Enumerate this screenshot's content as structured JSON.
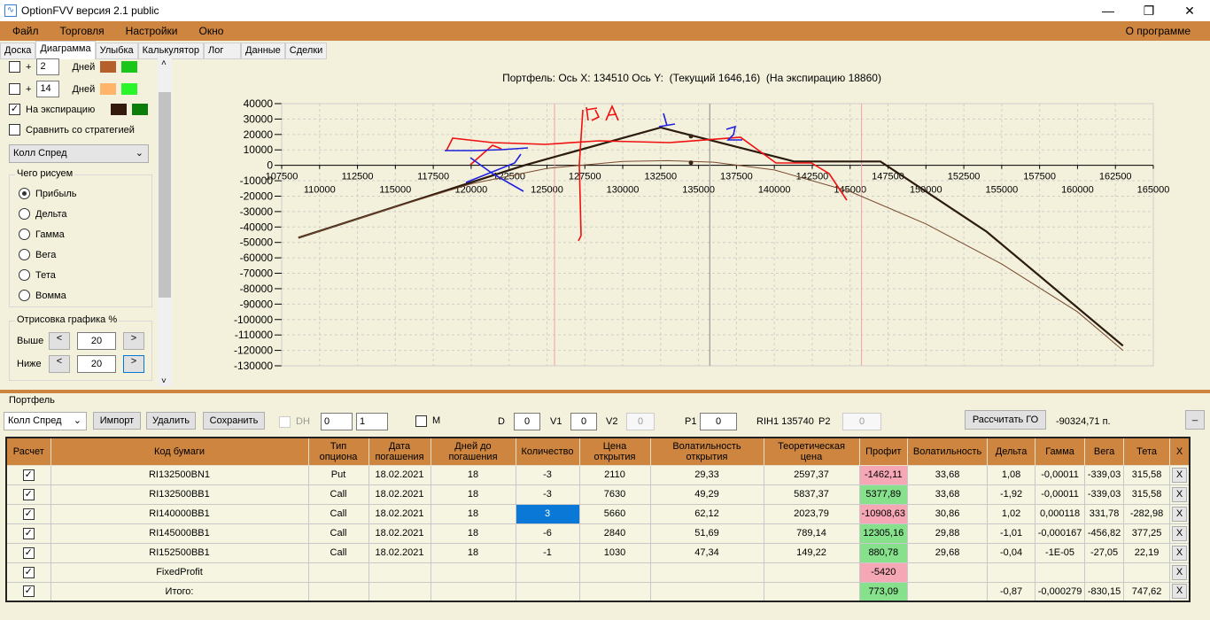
{
  "window": {
    "title": "OptionFVV версия 2.1 public",
    "minimize": "—",
    "maximize": "❐",
    "close": "✕"
  },
  "menu": {
    "items": [
      "Файл",
      "Торговля",
      "Настройки",
      "Окно"
    ],
    "about": "О программе"
  },
  "tabs": [
    "Доска",
    "Диаграмма",
    "Улыбка",
    "Калькулятор",
    "Лог",
    "Данные",
    "Сделки"
  ],
  "left": {
    "rows": [
      {
        "checked": false,
        "plus": "+",
        "days": "2",
        "unit": "Дней",
        "colors": [
          "#b5602b",
          "#19c619"
        ]
      },
      {
        "checked": false,
        "plus": "+",
        "days": "14",
        "unit": "Дней",
        "colors": [
          "#ffb46a",
          "#2af52a"
        ]
      }
    ],
    "expiry": {
      "checked": true,
      "label": "На экспирацию",
      "colors": [
        "#331a0a",
        "#0a7d0a"
      ]
    },
    "compare": {
      "checked": false,
      "label": "Сравнить со стратегией"
    },
    "strategy": "Колл Спред",
    "draw_group": "Чего рисуем",
    "draw_options": [
      "Прибыль",
      "Дельта",
      "Гамма",
      "Вега",
      "Тета",
      "Вомма"
    ],
    "selected_option": "Прибыль",
    "render_group": "Отрисовка графика %",
    "above_label": "Выше",
    "above": "20",
    "below_label": "Ниже",
    "below": "20",
    "prev": "<",
    "next": ">"
  },
  "chart_data": {
    "type": "line",
    "title": "Портфель: Ось X: 134510 Ось Y:  (Текущий 1646,16)  (На экспирацию 18860)",
    "xlim": [
      107500,
      165000
    ],
    "ylim": [
      -130000,
      40000
    ],
    "x_ticks_top": [
      107500,
      112500,
      117500,
      122500,
      127500,
      132500,
      137500,
      142500,
      147500,
      152500,
      157500,
      162500
    ],
    "x_ticks_bottom": [
      110000,
      115000,
      120000,
      125000,
      130000,
      135000,
      140000,
      145000,
      150000,
      155000,
      160000,
      165000
    ],
    "y_ticks": [
      40000,
      30000,
      20000,
      10000,
      0,
      -10000,
      -20000,
      -30000,
      -40000,
      -50000,
      -60000,
      -70000,
      -80000,
      -90000,
      -100000,
      -110000,
      -120000,
      -130000
    ],
    "grid": true,
    "vertical_lines": [
      {
        "x": 125500,
        "color": "#f5a0a8"
      },
      {
        "x": 135740,
        "color": "#888888"
      },
      {
        "x": 145750,
        "color": "#f5a0a8"
      }
    ],
    "series": [
      {
        "color": "#2b1a0e",
        "x": [
          108600,
          123500,
          132500,
          141300,
          147000,
          154000,
          163000
        ],
        "y": [
          -47000,
          0,
          24500,
          2500,
          2500,
          -43000,
          -117000
        ]
      },
      {
        "color": "#7a4a30",
        "x": [
          108600,
          115000,
          120000,
          125000,
          130000,
          133000,
          136000,
          140000,
          145000,
          150000,
          155000,
          160000,
          163000
        ],
        "y": [
          -47000,
          -27000,
          -12000,
          -2000,
          2500,
          3000,
          2000,
          -3000,
          -17000,
          -38000,
          -64000,
          -95000,
          -120000
        ]
      }
    ],
    "points": [
      {
        "x": 134500,
        "y": 18860
      },
      {
        "x": 134500,
        "y": 1646
      }
    ]
  },
  "portfolio": {
    "group": "Портфель",
    "strategy": "Колл Спред",
    "import": "Импорт",
    "delete": "Удалить",
    "save": "Сохранить",
    "dh": "DH",
    "spin1": "0",
    "spin2": "1",
    "m": "M",
    "d_label": "D",
    "d": "0",
    "v1_label": "V1",
    "v1": "0",
    "v2_label": "V2",
    "v2": "0",
    "p1_label": "P1",
    "p1": "0",
    "rih": "RIH1 135740",
    "p2_label": "P2",
    "p2": "0",
    "calc": "Рассчитать ГО",
    "go": "-90324,71 п.",
    "collapse": "_"
  },
  "table": {
    "headers": [
      "Расчет",
      "Код бумаги",
      "Тип опциона",
      "Дата погашения",
      "Дней до погашения",
      "Количество",
      "Цена открытия",
      "Волатильность открытия",
      "Теоретическая цена",
      "Профит",
      "Волатильность",
      "Дельта",
      "Гамма",
      "Вега",
      "Тета",
      "X"
    ],
    "rows": [
      [
        "RI132500BN1",
        "Put",
        "18.02.2021",
        "18",
        "-3",
        "2110",
        "29,33",
        "2597,37",
        "-1462,11",
        "33,68",
        "1,08",
        "-0,00011",
        "-339,03",
        "315,58",
        "pink"
      ],
      [
        "RI132500BB1",
        "Call",
        "18.02.2021",
        "18",
        "-3",
        "7630",
        "49,29",
        "5837,37",
        "5377,89",
        "33,68",
        "-1,92",
        "-0,00011",
        "-339,03",
        "315,58",
        "green"
      ],
      [
        "RI140000BB1",
        "Call",
        "18.02.2021",
        "18",
        "3",
        "5660",
        "62,12",
        "2023,79",
        "-10908,63",
        "30,86",
        "1,02",
        "0,000118",
        "331,78",
        "-282,98",
        "pink"
      ],
      [
        "RI145000BB1",
        "Call",
        "18.02.2021",
        "18",
        "-6",
        "2840",
        "51,69",
        "789,14",
        "12305,16",
        "29,88",
        "-1,01",
        "-0,000167",
        "-456,82",
        "377,25",
        "green"
      ],
      [
        "RI152500BB1",
        "Call",
        "18.02.2021",
        "18",
        "-1",
        "1030",
        "47,34",
        "149,22",
        "880,78",
        "29,68",
        "-0,04",
        "-1E-05",
        "-27,05",
        "22,19",
        "green"
      ],
      [
        "FixedProfit",
        "",
        "",
        "",
        "",
        "",
        "",
        "",
        "-5420",
        "",
        "",
        "",
        "",
        "",
        "pink"
      ],
      [
        "Итого:",
        "",
        "",
        "",
        "",
        "",
        "",
        "",
        "773,09",
        "",
        "-0,87",
        "-0,000279",
        "-830,15",
        "747,62",
        "green"
      ]
    ],
    "x": "X",
    "check": "✓"
  }
}
